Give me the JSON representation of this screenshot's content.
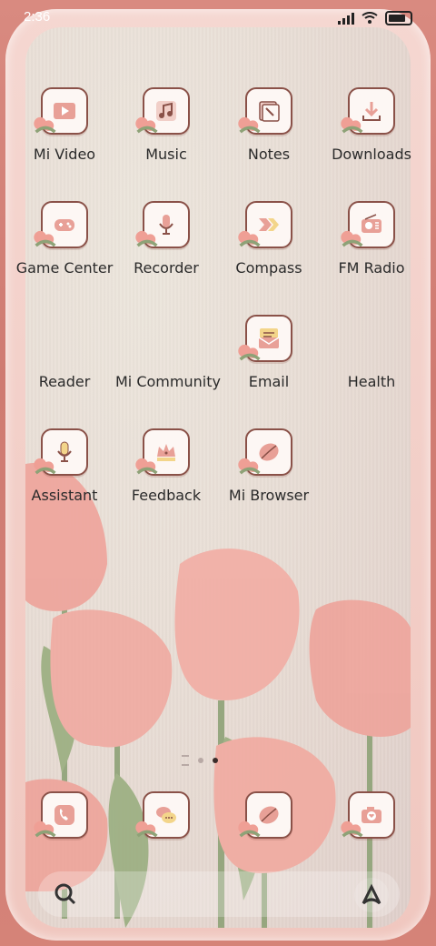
{
  "status": {
    "time": "2:36"
  },
  "apps": [
    {
      "label": "Mi Video",
      "icon": "mi-video-icon"
    },
    {
      "label": "Music",
      "icon": "music-icon"
    },
    {
      "label": "Notes",
      "icon": "notes-icon"
    },
    {
      "label": "Downloads",
      "icon": "downloads-icon"
    },
    {
      "label": "Game Center",
      "icon": "game-center-icon"
    },
    {
      "label": "Recorder",
      "icon": "recorder-icon"
    },
    {
      "label": "Compass",
      "icon": "compass-icon"
    },
    {
      "label": "FM Radio",
      "icon": "fm-radio-icon"
    },
    {
      "label": "Reader",
      "icon": "none"
    },
    {
      "label": "Mi Community",
      "icon": "none"
    },
    {
      "label": "Email",
      "icon": "email-icon"
    },
    {
      "label": "Health",
      "icon": "none"
    },
    {
      "label": "Assistant",
      "icon": "assistant-icon"
    },
    {
      "label": "Feedback",
      "icon": "feedback-icon"
    },
    {
      "label": "Mi Browser",
      "icon": "mi-browser-icon"
    }
  ],
  "dock": [
    "phone-icon",
    "messaging-icon",
    "browser-icon",
    "camera-icon"
  ],
  "colors": {
    "accent": "#e8a097",
    "frame": "#8a5148",
    "wallpaper": "#e8ddd5"
  }
}
